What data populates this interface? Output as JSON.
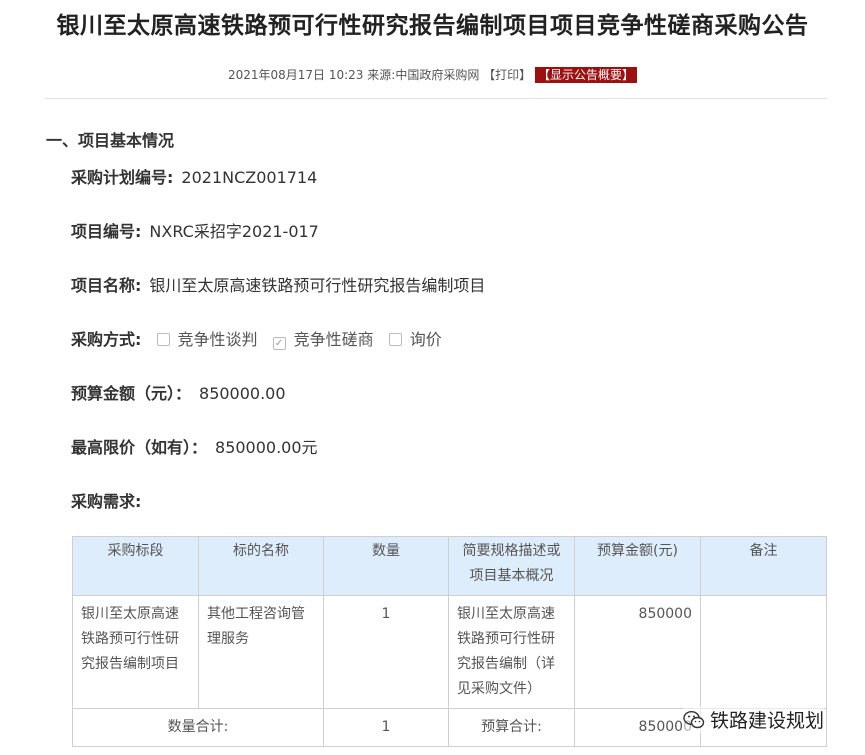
{
  "page_title": "银川至太原高速铁路预可行性研究报告编制项目项目竞争性磋商采购公告",
  "meta": {
    "datetime": "2021年08月17日 10:23",
    "source_label": "来源:",
    "source": "中国政府采购网",
    "print_label": "【打印】",
    "summary_button": "【显示公告概要】"
  },
  "section1": {
    "title": "一、项目基本情况",
    "plan_no": {
      "label": "采购计划编号:",
      "value": "2021NCZ001714"
    },
    "project_no": {
      "label": "项目编号:",
      "value": "NXRC采招字2021-017"
    },
    "project_name": {
      "label": "项目名称:",
      "value": "银川至太原高速铁路预可行性研究报告编制项目"
    },
    "method": {
      "label": "采购方式:",
      "options": [
        {
          "label": "竞争性谈判",
          "checked": false
        },
        {
          "label": "竞争性磋商",
          "checked": true
        },
        {
          "label": "询价",
          "checked": false
        }
      ]
    },
    "budget": {
      "label": "预算金额（元）：",
      "value": "850000.00"
    },
    "max_price": {
      "label": "最高限价（如有）：",
      "value": "850000.00元"
    },
    "requirements_label": "采购需求:"
  },
  "table": {
    "headers": [
      "采购标段",
      "标的名称",
      "数量",
      "简要规格描述或项目基本概况",
      "预算金额(元)",
      "备注"
    ],
    "rows": [
      [
        "银川至太原高速铁路预可行性研究报告编制项目",
        "其他工程咨询管理服务",
        "1",
        "银川至太原高速铁路预可行性研究报告编制（详见采购文件）",
        "850000",
        ""
      ]
    ],
    "total": {
      "qty_label": "数量合计:",
      "qty_value": "1",
      "budget_label": "预算合计:",
      "budget_value": "850000"
    }
  },
  "watermark": {
    "text": "铁路建设规划",
    "icon": "wechat-icon"
  }
}
